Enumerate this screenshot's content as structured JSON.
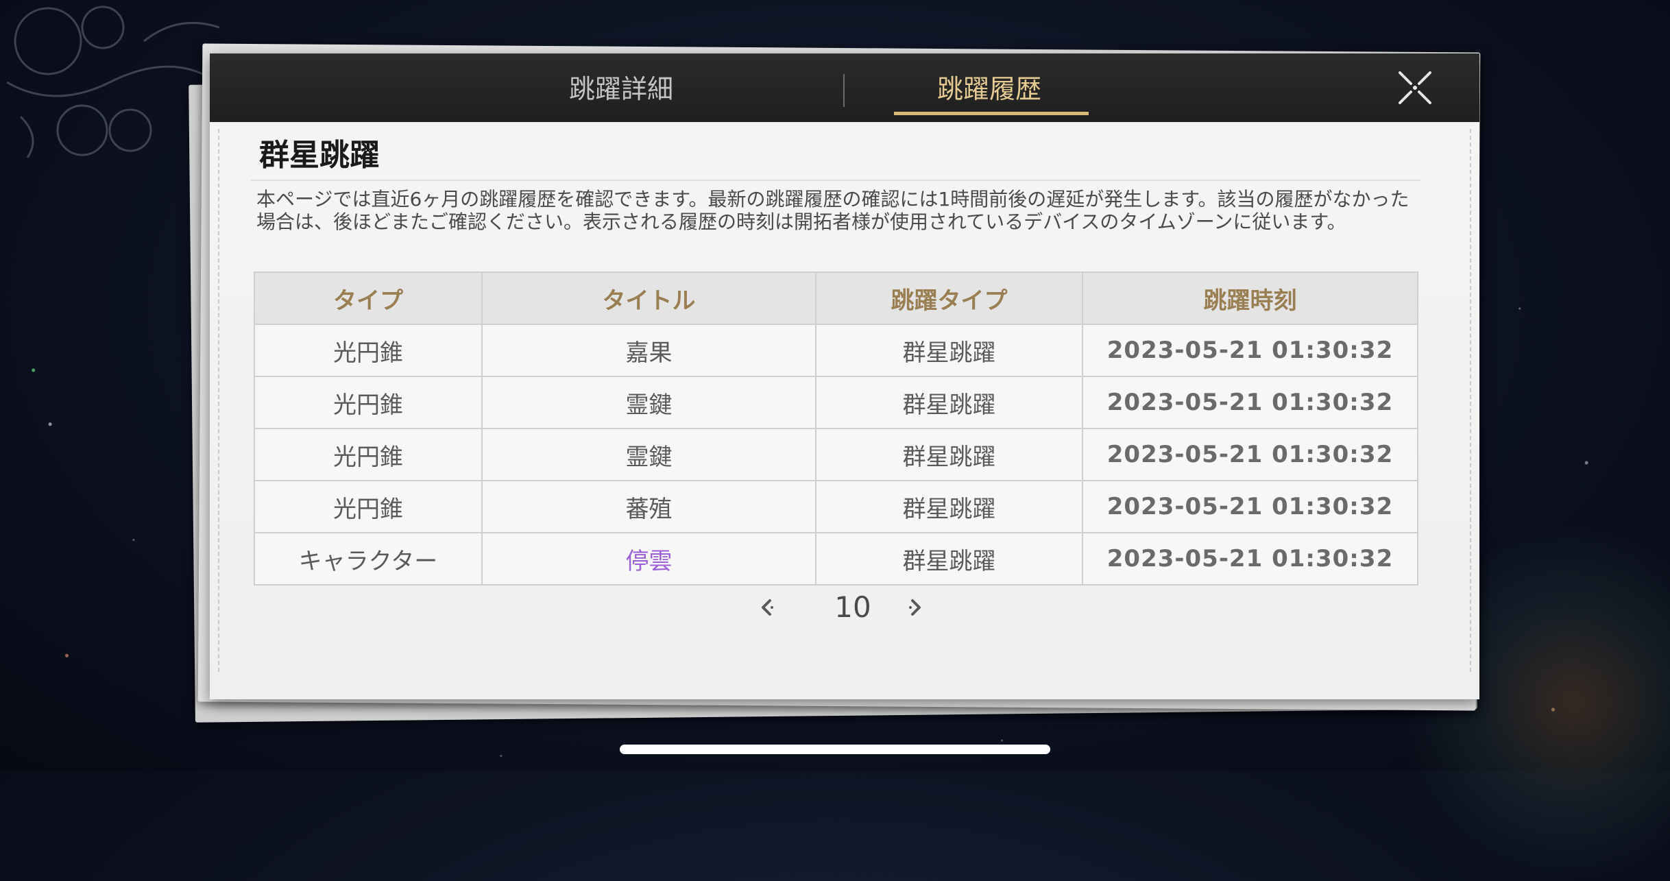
{
  "tabs": {
    "details": "跳躍詳細",
    "history": "跳躍履歴"
  },
  "section": {
    "title": "群星跳躍",
    "description": "本ページでは直近6ヶ月の跳躍履歴を確認できます。最新の跳躍履歴の確認には1時間前後の遅延が発生します。該当の履歴がなかった場合は、後ほどまたご確認ください。表示される履歴の時刻は開拓者様が使用されているデバイスのタイムゾーンに従います。"
  },
  "table": {
    "headers": [
      "タイプ",
      "タイトル",
      "跳躍タイプ",
      "跳躍時刻"
    ],
    "rows": [
      [
        "光円錐",
        "嘉果",
        "群星跳躍",
        "2023-05-21 01:30:32"
      ],
      [
        "光円錐",
        "霊鍵",
        "群星跳躍",
        "2023-05-21 01:30:32"
      ],
      [
        "光円錐",
        "霊鍵",
        "群星跳躍",
        "2023-05-21 01:30:32"
      ],
      [
        "光円錐",
        "蕃殖",
        "群星跳躍",
        "2023-05-21 01:30:32"
      ],
      [
        "キャラクター",
        "停雲",
        "群星跳躍",
        "2023-05-21 01:30:32"
      ]
    ]
  },
  "pager": {
    "page": "10"
  },
  "icons": {
    "close": "close-icon",
    "prev": "chevron-left-icon",
    "next": "chevron-right-icon"
  },
  "colors": {
    "tab_active": "#e6cb93",
    "header_text": "#9a7f52",
    "rare_item": "#9b5fd6"
  }
}
